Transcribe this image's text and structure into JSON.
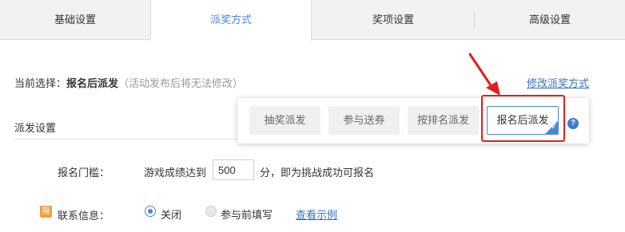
{
  "tabs": [
    {
      "label": "基础设置"
    },
    {
      "label": "派奖方式"
    },
    {
      "label": "奖项设置"
    },
    {
      "label": "高级设置"
    }
  ],
  "current": {
    "label": "当前选择：",
    "value": "报名后派发",
    "note": "（活动发布后将无法修改）",
    "modify_link": "修改派奖方式"
  },
  "section": {
    "title": "派发设置"
  },
  "popup": {
    "options": [
      {
        "label": "抽奖派发"
      },
      {
        "label": "参与送券"
      },
      {
        "label": "按排名派发"
      },
      {
        "label": "报名后派发"
      }
    ],
    "selected_index": 3,
    "help_icon": "?"
  },
  "threshold": {
    "label": "报名门槛：",
    "text_before": "游戏成绩达到",
    "value": "500",
    "text_after": "分，即为挑战成功可报名"
  },
  "contact": {
    "icon_char": "限",
    "label": "联系信息：",
    "options": [
      {
        "label": "关闭",
        "checked": true
      },
      {
        "label": "参与前填写",
        "checked": false
      }
    ],
    "example_link": "查看示例"
  },
  "colors": {
    "accent": "#4a86d8",
    "link": "#3b6fc2",
    "annotation": "#e51c1c",
    "badge": "#f0a040"
  },
  "icons": {
    "help": "question-circle-icon",
    "selected": "check-corner-icon",
    "contact_badge": "badge-icon",
    "annotation_arrow": "red-arrow-icon"
  }
}
